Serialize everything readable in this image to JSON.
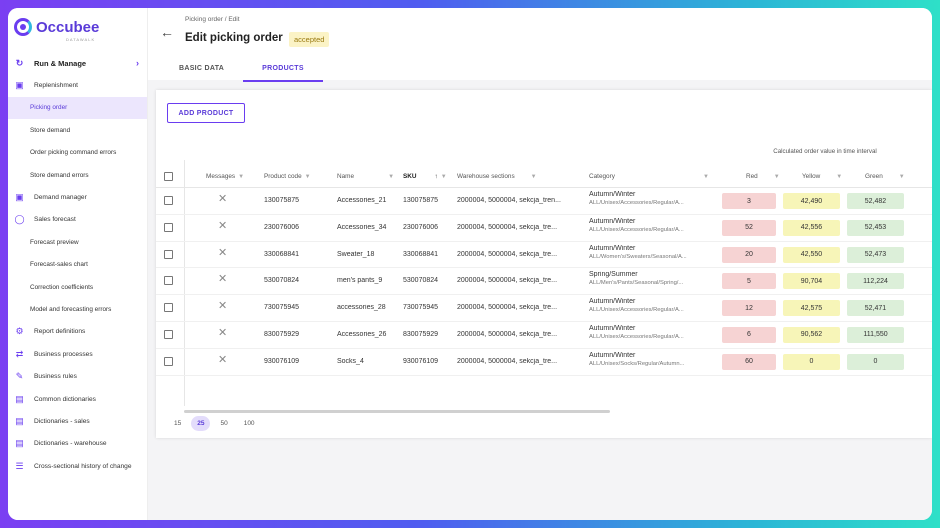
{
  "app": {
    "logo_text": "Occubee",
    "logo_sub": "DATAWALK"
  },
  "sidebar": {
    "items": [
      {
        "label": "Run & Manage",
        "icon": "sync-icon",
        "type": "top"
      },
      {
        "label": "Replenishment",
        "icon": "briefcase-icon",
        "type": "icon"
      },
      {
        "label": "Picking order",
        "type": "sub",
        "active": true
      },
      {
        "label": "Store demand",
        "type": "sub"
      },
      {
        "label": "Order picking command errors",
        "type": "sub"
      },
      {
        "label": "Store demand errors",
        "type": "sub"
      },
      {
        "label": "Demand manager",
        "icon": "briefcase-icon",
        "type": "icon"
      },
      {
        "label": "Sales forecast",
        "icon": "bulb-icon",
        "type": "icon"
      },
      {
        "label": "Forecast preview",
        "type": "sub"
      },
      {
        "label": "Forecast-sales chart",
        "type": "sub"
      },
      {
        "label": "Correction coefficients",
        "type": "sub"
      },
      {
        "label": "Model and forecasting errors",
        "type": "sub"
      },
      {
        "label": "Report definitions",
        "icon": "report-icon",
        "type": "icon"
      },
      {
        "label": "Business processes",
        "icon": "swap-icon",
        "type": "icon"
      },
      {
        "label": "Business rules",
        "icon": "rules-icon",
        "type": "icon"
      },
      {
        "label": "Common dictionaries",
        "icon": "book-icon",
        "type": "icon"
      },
      {
        "label": "Dictionaries - sales",
        "icon": "book-icon",
        "type": "icon"
      },
      {
        "label": "Dictionaries - warehouse",
        "icon": "book-icon",
        "type": "icon"
      },
      {
        "label": "Cross-sectional history of change",
        "icon": "history-icon",
        "type": "icon"
      }
    ]
  },
  "header": {
    "breadcrumb": "Picking order / Edit",
    "title": "Edit picking order",
    "status": "accepted",
    "tabs": [
      {
        "label": "BASIC DATA"
      },
      {
        "label": "PRODUCTS"
      }
    ]
  },
  "table": {
    "add_button": "ADD PRODUCT",
    "group_header": "Calculated order value in time interval",
    "columns": {
      "messages": "Messages",
      "product_code": "Product code",
      "name": "Name",
      "sku": "SKU",
      "warehouse": "Warehouse sections",
      "category": "Category",
      "red": "Red",
      "yellow": "Yellow",
      "green": "Green"
    },
    "rows": [
      {
        "code": "130075875",
        "name": "Accessories_21",
        "sku": "130075875",
        "wh": "2000004, 5000004, sekcja_tren...",
        "cat": "Autumn/Winter",
        "cat_path": "ALL/Unisex/Accessories/Regular/A...",
        "red": "3",
        "yellow": "42,490",
        "green": "52,482"
      },
      {
        "code": "230076006",
        "name": "Accessories_34",
        "sku": "230076006",
        "wh": "2000004, 5000004, sekcja_tre...",
        "cat": "Autumn/Winter",
        "cat_path": "ALL/Unisex/Accessories/Regular/A...",
        "red": "52",
        "yellow": "42,556",
        "green": "52,453"
      },
      {
        "code": "330068841",
        "name": "Sweater_18",
        "sku": "330068841",
        "wh": "2000004, 5000004, sekcja_tre...",
        "cat": "Autumn/Winter",
        "cat_path": "ALL/Women's/Sweaters/Seasonal/A...",
        "red": "20",
        "yellow": "42,550",
        "green": "52,473"
      },
      {
        "code": "530070824",
        "name": "men's pants_9",
        "sku": "530070824",
        "wh": "2000004, 5000004, sekcja_tre...",
        "cat": "Spring/Summer",
        "cat_path": "ALL/Men's/Pants/Seasonal/Spring/...",
        "red": "5",
        "yellow": "90,704",
        "green": "112,224"
      },
      {
        "code": "730075945",
        "name": "accessories_28",
        "sku": "730075945",
        "wh": "2000004, 5000004, sekcja_tre...",
        "cat": "Autumn/Winter",
        "cat_path": "ALL/Unisex/Accessories/Regular/A...",
        "red": "12",
        "yellow": "42,575",
        "green": "52,471"
      },
      {
        "code": "830075929",
        "name": "Accessories_26",
        "sku": "830075929",
        "wh": "2000004, 5000004, sekcja_tre...",
        "cat": "Autumn/Winter",
        "cat_path": "ALL/Unisex/Accessories/Regular/A...",
        "red": "6",
        "yellow": "90,562",
        "green": "111,550"
      },
      {
        "code": "930076109",
        "name": "Socks_4",
        "sku": "930076109",
        "wh": "2000004, 5000004, sekcja_tre...",
        "cat": "Autumn/Winter",
        "cat_path": "ALL/Unisex/Socks/Regular/Autumn...",
        "red": "60",
        "yellow": "0",
        "green": "0"
      }
    ],
    "page_sizes": [
      "15",
      "25",
      "50",
      "100"
    ],
    "page_size_selected": "25"
  },
  "colors": {
    "accent": "#6a3df0",
    "red_bg": "#f6d3d3",
    "yellow_bg": "#f7f5b8",
    "green_bg": "#dcefd9"
  }
}
